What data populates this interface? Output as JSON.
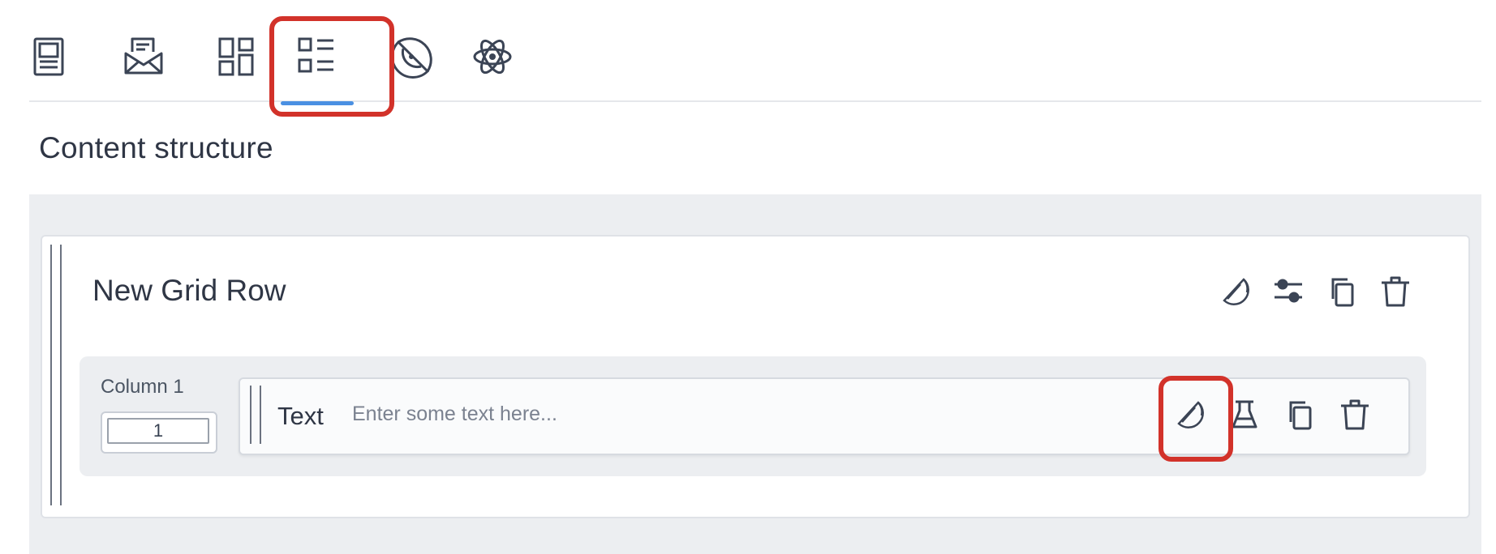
{
  "tabs": [
    {
      "icon": "page-icon",
      "active": false
    },
    {
      "icon": "email-icon",
      "active": false
    },
    {
      "icon": "layout-grid-icon",
      "active": false
    },
    {
      "icon": "content-structure-icon",
      "active": true
    },
    {
      "icon": "style-fruit-icon",
      "active": false
    },
    {
      "icon": "atom-icon",
      "active": false
    }
  ],
  "section": {
    "title": "Content structure"
  },
  "grid_row": {
    "title": "New Grid Row",
    "toolbar": [
      "style-icon",
      "settings-sliders-icon",
      "duplicate-icon",
      "delete-icon"
    ]
  },
  "column": {
    "label": "Column 1",
    "width_value": "1"
  },
  "text_block": {
    "label": "Text",
    "placeholder": "Enter some text here...",
    "toolbar": [
      "style-icon",
      "flask-icon",
      "duplicate-icon",
      "delete-icon"
    ]
  },
  "colors": {
    "accent": "#4a90e2",
    "highlight": "#d2322a",
    "canvas": "#eceef1",
    "icon": "#3b4455"
  }
}
